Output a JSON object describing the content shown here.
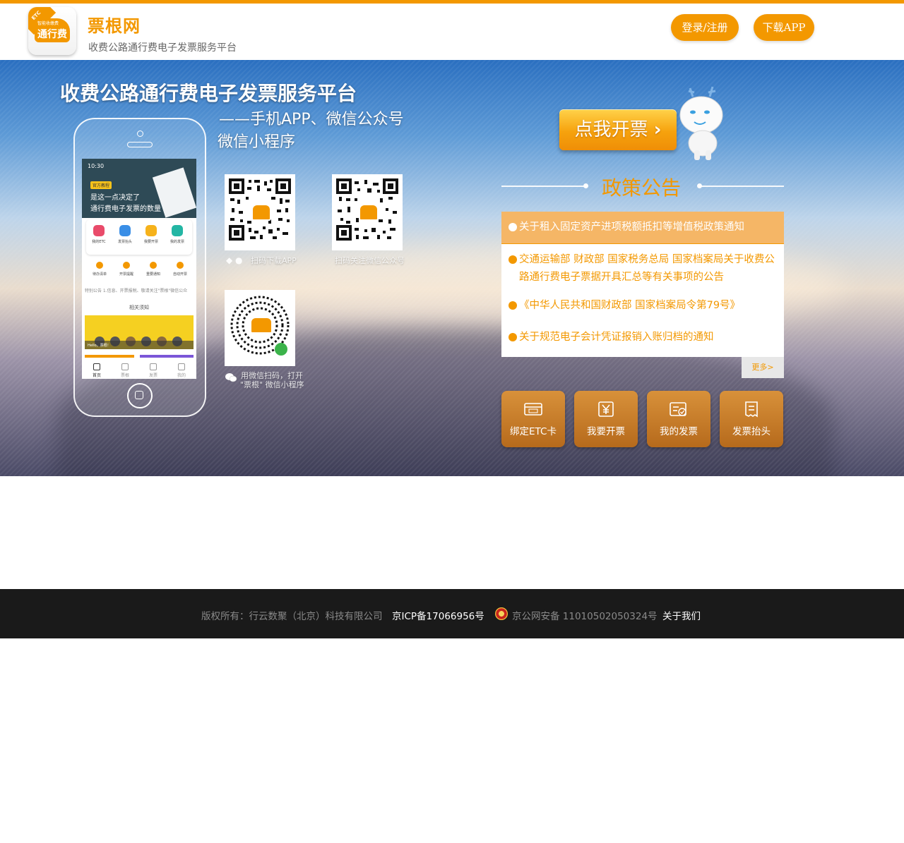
{
  "header": {
    "logo": {
      "corner_text": "ETC",
      "small_text": "智能收缴费",
      "main_text": "通行费"
    },
    "brand_title": "票根网",
    "brand_subtitle": "收费公路通行费电子发票服务平台",
    "login_label": "登录/注册",
    "download_label": "下载APP"
  },
  "banner": {
    "title": "收费公路通行费电子发票服务平台",
    "subtitle_line1": "——手机APP、微信公众号",
    "subtitle_line2": "微信小程序",
    "phone": {
      "time": "10:30",
      "tag": "官方教程",
      "headline1": "是这一点决定了",
      "headline2": "通行费电子发票的数量",
      "icons": [
        "我的ETC",
        "发票抬头",
        "我要开票",
        "我的发票"
      ],
      "icons2": [
        "待办清单",
        "开票提醒",
        "重要通知",
        "自动开票"
      ],
      "notice": "特别公告 1.信息、开票报税、敬请关注\"票根\"微信公众",
      "related": "相关须知",
      "hello": "Hello，票根！",
      "nav": [
        "首页",
        "票根",
        "发票",
        "我的"
      ]
    },
    "qr_app_caption": "扫码下载APP",
    "qr_wechat_caption": "扫码关注微信公众号",
    "qr_mini_caption_line1": "用微信扫码，打开",
    "qr_mini_caption_line2": "\"票根\" 微信小程序",
    "qr_center_text": "通行费",
    "cta_label": "点我开票",
    "cta_arrow": "›"
  },
  "policy": {
    "title": "政策公告",
    "items": [
      {
        "text": "关于租入固定资产进项税额抵扣等增值税政策通知"
      },
      {
        "text": "交通运输部 财政部 国家税务总局 国家档案局关于收费公路通行费电子票据开具汇总等有关事项的公告"
      },
      {
        "text": "《中华人民共和国财政部 国家档案局令第79号》"
      },
      {
        "text": "关于规范电子会计凭证报销入账归档的通知"
      }
    ],
    "more_label": "更多>"
  },
  "quick_actions": [
    {
      "label": "绑定ETC卡",
      "icon": "etc-card-icon"
    },
    {
      "label": "我要开票",
      "icon": "yuan-icon"
    },
    {
      "label": "我的发票",
      "icon": "invoice-check-icon"
    },
    {
      "label": "发票抬头",
      "icon": "receipt-icon"
    }
  ],
  "footer": {
    "copyright": "版权所有：行云数聚（北京）科技有限公司",
    "icp": "京ICP备17066956号",
    "police": "京公网安备 11010502050324号",
    "about": "关于我们"
  },
  "colors": {
    "accent": "#f39800",
    "footer_bg": "#1a1a1a",
    "active_item": "#f5b666"
  }
}
